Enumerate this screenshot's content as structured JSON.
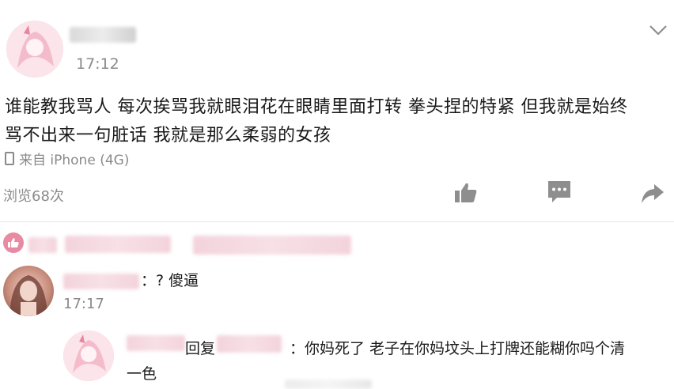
{
  "post": {
    "time": "17:12",
    "text_line1": "谁能教我骂人 每次挨骂我就眼泪花在眼睛里面打转 拳头捏的特紧 但我就是始终",
    "text_line2": "骂不出来一句脏话 我就是那么柔弱的女孩",
    "source": "来自 iPhone (4G)",
    "views": "浏览68次"
  },
  "comment": {
    "text": "：? 傻逼",
    "time": "17:17"
  },
  "reply": {
    "prefix": "回复",
    "text_line1": "：你妈死了 老子在你妈坟头上打牌还能糊你吗个清",
    "text_line2": "一色"
  },
  "icons": {
    "dropdown": "chevron-down-icon",
    "device": "phone-icon",
    "like": "thumbs-up-icon",
    "comment": "comment-icon",
    "share": "share-icon",
    "liked_by": "heart-badge-icon"
  },
  "colors": {
    "accent_pink": "#e98aa3",
    "meta_gray": "#8a8a8a",
    "icon_gray": "#8e8e8e"
  }
}
